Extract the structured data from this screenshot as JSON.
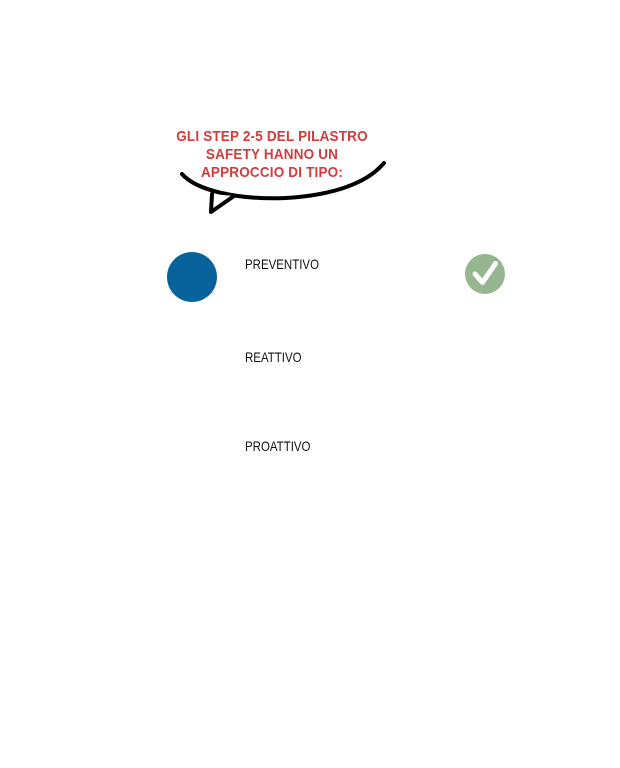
{
  "question": {
    "lines": [
      "GLI STEP 2-5 DEL PILASTRO",
      "SAFETY HANNO UN",
      "APPROCCIO DI TIPO:"
    ]
  },
  "options": [
    {
      "label": "PREVENTIVO",
      "selected": true,
      "correct": true
    },
    {
      "label": "REATTIVO",
      "selected": false,
      "correct": false
    },
    {
      "label": "PROATTIVO",
      "selected": false,
      "correct": false
    }
  ],
  "icons": {
    "speech_tail": "speech-bubble-tail-icon",
    "correct_mark": "check-circle-icon"
  },
  "colors": {
    "question_text": "#d23c3c",
    "selection_circle": "#08639c",
    "correct_badge": "#95b68e",
    "option_text": "#111111"
  }
}
